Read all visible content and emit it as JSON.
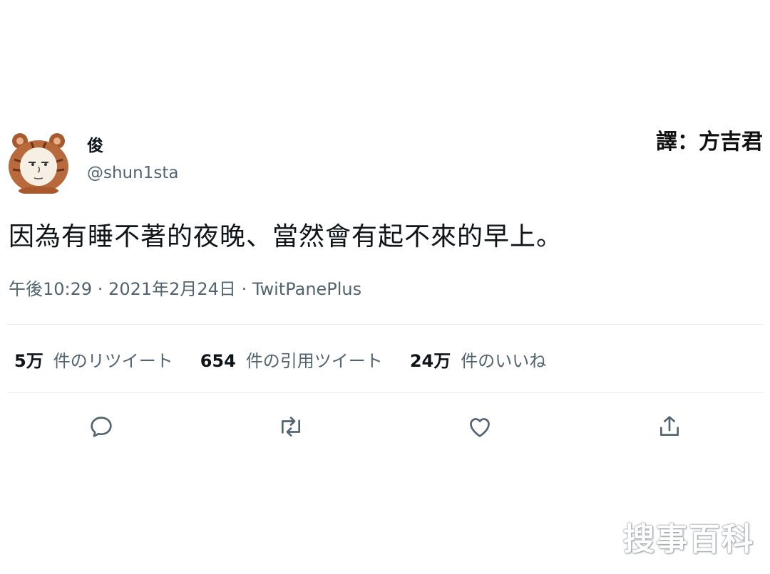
{
  "tweet": {
    "display_name": "俊",
    "handle": "@shun1sta",
    "text": "因為有睡不著的夜晚、當然會有起不來的早上。",
    "meta": "午後10:29 · 2021年2月24日 · TwitPanePlus"
  },
  "overlay": {
    "translator": "譯：方吉君",
    "watermark": "搜事百科"
  },
  "stats": [
    {
      "count": "5万",
      "label": "件のリツイート"
    },
    {
      "count": "654",
      "label": "件の引用ツイート"
    },
    {
      "count": "24万",
      "label": "件のいいね"
    }
  ],
  "actions": [
    "reply-icon",
    "retweet-icon",
    "like-icon",
    "share-icon"
  ],
  "colors": {
    "text_primary": "#0f1419",
    "text_secondary": "#536471",
    "divider": "#e6ecf0",
    "icon": "#536471",
    "avatar_hood": "#b86a3c"
  }
}
